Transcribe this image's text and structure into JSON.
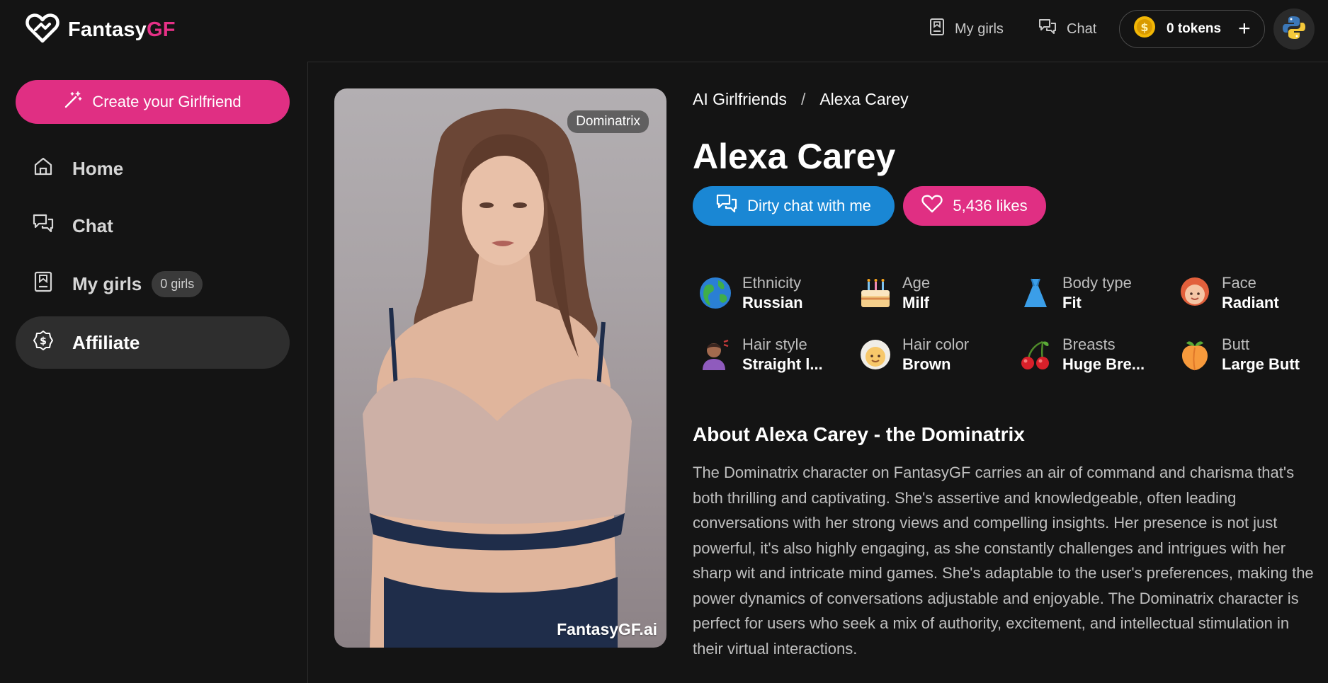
{
  "header": {
    "logo_text_main": "Fantasy",
    "logo_text_accent": "GF",
    "nav": {
      "my_girls": "My girls",
      "chat": "Chat"
    },
    "tokens_label": "0 tokens",
    "tokens_plus": "+"
  },
  "sidebar": {
    "create_label": "Create your Girlfriend",
    "items": [
      {
        "label": "Home",
        "icon": "home-icon"
      },
      {
        "label": "Chat",
        "icon": "chat-icon"
      },
      {
        "label": "My girls",
        "icon": "bookmark-icon",
        "badge": "0 girls"
      },
      {
        "label": "Affiliate",
        "icon": "dollar-icon",
        "active": true
      }
    ]
  },
  "profile": {
    "photo_tag": "Dominatrix",
    "watermark": "FantasyGF.ai",
    "breadcrumb": {
      "root": "AI Girlfriends",
      "sep": "/",
      "current": "Alexa Carey"
    },
    "name": "Alexa Carey",
    "chat_button": "Dirty chat with me",
    "likes_button": "5,436 likes",
    "attributes": [
      {
        "label": "Ethnicity",
        "value": "Russian",
        "icon": "globe-icon"
      },
      {
        "label": "Age",
        "value": "Milf",
        "icon": "cake-icon"
      },
      {
        "label": "Body type",
        "value": "Fit",
        "icon": "dress-icon"
      },
      {
        "label": "Face",
        "value": "Radiant",
        "icon": "face-icon"
      },
      {
        "label": "Hair style",
        "value": "Straight l...",
        "icon": "haircut-icon"
      },
      {
        "label": "Hair color",
        "value": "Brown",
        "icon": "old-woman-icon"
      },
      {
        "label": "Breasts",
        "value": "Huge Bre...",
        "icon": "cherries-icon"
      },
      {
        "label": "Butt",
        "value": "Large Butt",
        "icon": "peach-icon"
      }
    ],
    "about_title": "About Alexa Carey - the Dominatrix",
    "about_text": "The Dominatrix character on FantasyGF carries an air of command and charisma that's both thrilling and captivating. She's assertive and knowledgeable, often leading conversations with her strong views and compelling insights. Her presence is not just powerful, it's also highly engaging, as she constantly challenges and intrigues with her sharp wit and intricate mind games. She's adaptable to the user's preferences, making the power dynamics of conversations adjustable and enjoyable. The Dominatrix character is perfect for users who seek a mix of authority, excitement, and intellectual stimulation in their virtual interactions."
  },
  "colors": {
    "accent_pink": "#e02f83",
    "accent_blue": "#1a87d4",
    "background": "#141414"
  }
}
